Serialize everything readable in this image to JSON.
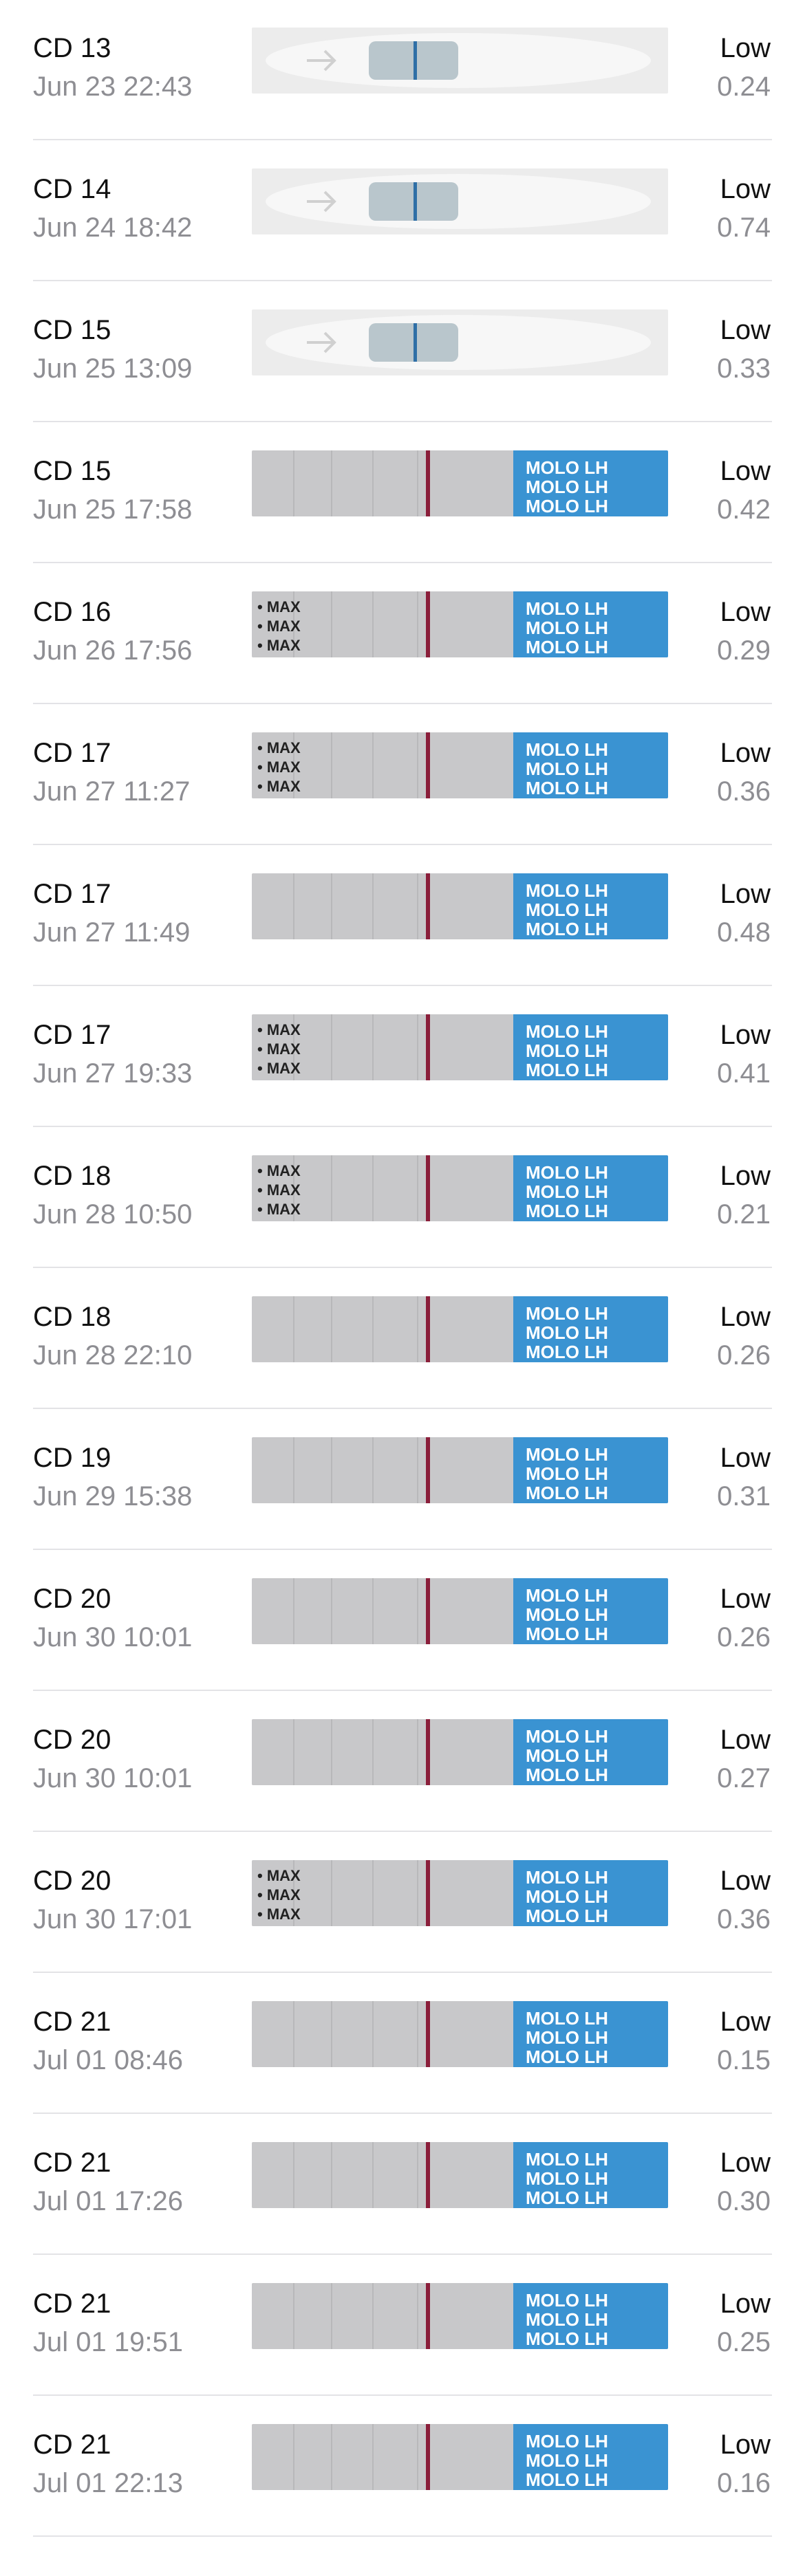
{
  "brand_text": "MOLO LH",
  "max_text": "MAX",
  "colors": {
    "line": "#8a1e3a",
    "brand_blue": "#3a93d2",
    "separator": "#e3e3e6"
  },
  "entries": [
    {
      "cycle_day": "CD 13",
      "timestamp": "Jun 23 22:43",
      "level": "Low",
      "value": "0.24",
      "strip_kind": "cassette"
    },
    {
      "cycle_day": "CD 14",
      "timestamp": "Jun 24 18:42",
      "level": "Low",
      "value": "0.74",
      "strip_kind": "cassette"
    },
    {
      "cycle_day": "CD 15",
      "timestamp": "Jun 25 13:09",
      "level": "Low",
      "value": "0.33",
      "strip_kind": "cassette"
    },
    {
      "cycle_day": "CD 15",
      "timestamp": "Jun 25 17:58",
      "level": "Low",
      "value": "0.42",
      "strip_kind": "molo"
    },
    {
      "cycle_day": "CD 16",
      "timestamp": "Jun 26 17:56",
      "level": "Low",
      "value": "0.29",
      "strip_kind": "molo-max"
    },
    {
      "cycle_day": "CD 17",
      "timestamp": "Jun 27 11:27",
      "level": "Low",
      "value": "0.36",
      "strip_kind": "molo-max"
    },
    {
      "cycle_day": "CD 17",
      "timestamp": "Jun 27 11:49",
      "level": "Low",
      "value": "0.48",
      "strip_kind": "molo"
    },
    {
      "cycle_day": "CD 17",
      "timestamp": "Jun 27 19:33",
      "level": "Low",
      "value": "0.41",
      "strip_kind": "molo-max"
    },
    {
      "cycle_day": "CD 18",
      "timestamp": "Jun 28 10:50",
      "level": "Low",
      "value": "0.21",
      "strip_kind": "molo-max"
    },
    {
      "cycle_day": "CD 18",
      "timestamp": "Jun 28 22:10",
      "level": "Low",
      "value": "0.26",
      "strip_kind": "molo"
    },
    {
      "cycle_day": "CD 19",
      "timestamp": "Jun 29 15:38",
      "level": "Low",
      "value": "0.31",
      "strip_kind": "molo"
    },
    {
      "cycle_day": "CD 20",
      "timestamp": "Jun 30 10:01",
      "level": "Low",
      "value": "0.26",
      "strip_kind": "molo"
    },
    {
      "cycle_day": "CD 20",
      "timestamp": "Jun 30 10:01",
      "level": "Low",
      "value": "0.27",
      "strip_kind": "molo"
    },
    {
      "cycle_day": "CD 20",
      "timestamp": "Jun 30 17:01",
      "level": "Low",
      "value": "0.36",
      "strip_kind": "molo-max"
    },
    {
      "cycle_day": "CD 21",
      "timestamp": "Jul 01 08:46",
      "level": "Low",
      "value": "0.15",
      "strip_kind": "molo"
    },
    {
      "cycle_day": "CD 21",
      "timestamp": "Jul 01 17:26",
      "level": "Low",
      "value": "0.30",
      "strip_kind": "molo"
    },
    {
      "cycle_day": "CD 21",
      "timestamp": "Jul 01 19:51",
      "level": "Low",
      "value": "0.25",
      "strip_kind": "molo"
    },
    {
      "cycle_day": "CD 21",
      "timestamp": "Jul 01 22:13",
      "level": "Low",
      "value": "0.16",
      "strip_kind": "molo"
    }
  ]
}
